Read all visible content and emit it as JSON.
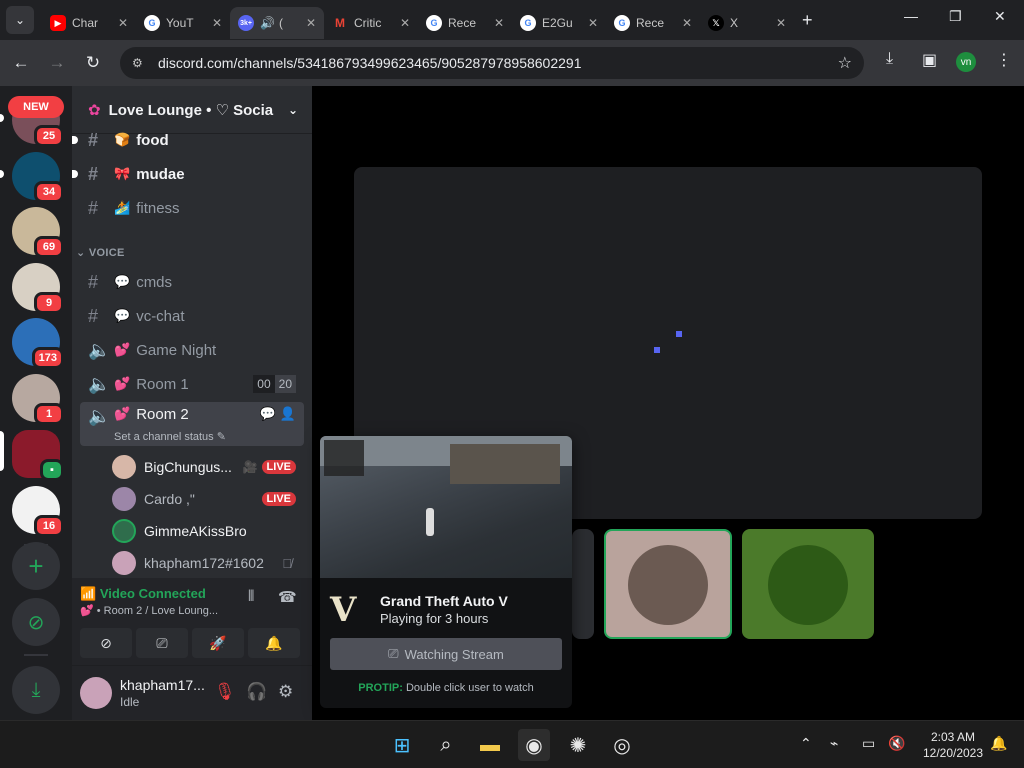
{
  "browser": {
    "tabs": [
      {
        "title": "Char",
        "icon": "youtube-icon",
        "color": "#ff0000"
      },
      {
        "title": "YouT",
        "icon": "google-icon",
        "color": "#4285f4"
      },
      {
        "title": "(",
        "icon": "discord-icon",
        "color": "#5865f2",
        "badge": "3k+",
        "active": true
      },
      {
        "title": "Critic",
        "icon": "gmail-icon",
        "color": "#ea4335"
      },
      {
        "title": "Rece",
        "icon": "google-icon",
        "color": "#4285f4"
      },
      {
        "title": "E2Gu",
        "icon": "google-icon",
        "color": "#4285f4"
      },
      {
        "title": "Rece",
        "icon": "google-icon",
        "color": "#4285f4"
      },
      {
        "title": "X",
        "icon": "x-icon",
        "color": "#000000"
      }
    ],
    "url": "discord.com/channels/534186793499623465/905287978958602291",
    "profile_initials": "vn"
  },
  "servers": {
    "new_label": "NEW",
    "badges": [
      "25",
      "34",
      "69",
      "9",
      "173",
      "1",
      "",
      "16"
    ]
  },
  "guild": {
    "name": "Love Lounge • ♡ Socia",
    "text_channels": [
      {
        "name": "food",
        "emoji": "🍞",
        "unread": true
      },
      {
        "name": "mudae",
        "emoji": "🎀",
        "unread": true
      },
      {
        "name": "fitness",
        "emoji": "🏄",
        "unread": false
      }
    ],
    "voice_category": "VOICE",
    "voice_channels": [
      {
        "name": "cmds",
        "emoji": "💬",
        "type": "text"
      },
      {
        "name": "vc-chat",
        "emoji": "💬",
        "type": "text"
      },
      {
        "name": "Game Night",
        "emoji": "💕",
        "type": "voice"
      },
      {
        "name": "Room 1",
        "emoji": "💕",
        "type": "voice",
        "counts": [
          "00",
          "20"
        ]
      },
      {
        "name": "Room 2",
        "emoji": "💕",
        "type": "voice"
      }
    ],
    "room2_status": "Set a channel status",
    "voice_users": [
      {
        "name": "BigChungus...",
        "live": "LIVE",
        "camera": true
      },
      {
        "name": "Cardo ,\"",
        "live": "LIVE"
      },
      {
        "name": "GimmeAKissBro",
        "live": ""
      },
      {
        "name": "khapham172#1602",
        "live": "",
        "muted": true
      }
    ]
  },
  "voice_panel": {
    "title": "Video Connected",
    "subtitle": "Room 2 / Love Loung..."
  },
  "user": {
    "name": "khapham17...",
    "status": "Idle"
  },
  "popup": {
    "game": "Grand Theft Auto V",
    "time": "Playing for 3 hours",
    "button": "Watching Stream",
    "tip_label": "PROTIP:",
    "tip_text": "Double click user to watch",
    "logo": "V"
  },
  "taskbar": {
    "time": "2:03 AM",
    "date": "12/20/2023"
  },
  "colors": {
    "accent_green": "#23a559",
    "badge_red": "#f23f43",
    "blurple": "#5865f2"
  }
}
